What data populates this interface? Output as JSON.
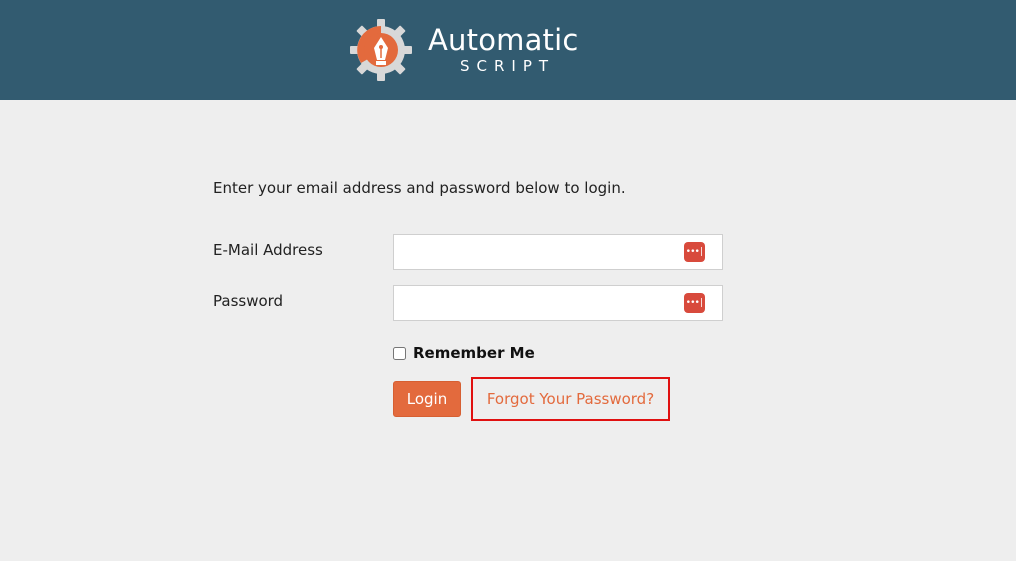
{
  "header": {
    "logo_title": "Automatic",
    "logo_subtitle": "SCRIPT",
    "logo_icon": "gear-pen-nib-icon"
  },
  "form": {
    "intro": "Enter your email address and password below to login.",
    "email_label": "E-Mail Address",
    "email_value": "",
    "password_label": "Password",
    "password_value": "",
    "password_manager_icon": "password-manager-icon",
    "remember_label": "Remember Me",
    "remember_checked": false,
    "login_label": "Login",
    "forgot_label": "Forgot Your Password?"
  },
  "colors": {
    "header_bg": "#325b70",
    "page_bg": "#eeeeee",
    "accent": "#e36a3d",
    "highlight_border": "#e01010"
  }
}
